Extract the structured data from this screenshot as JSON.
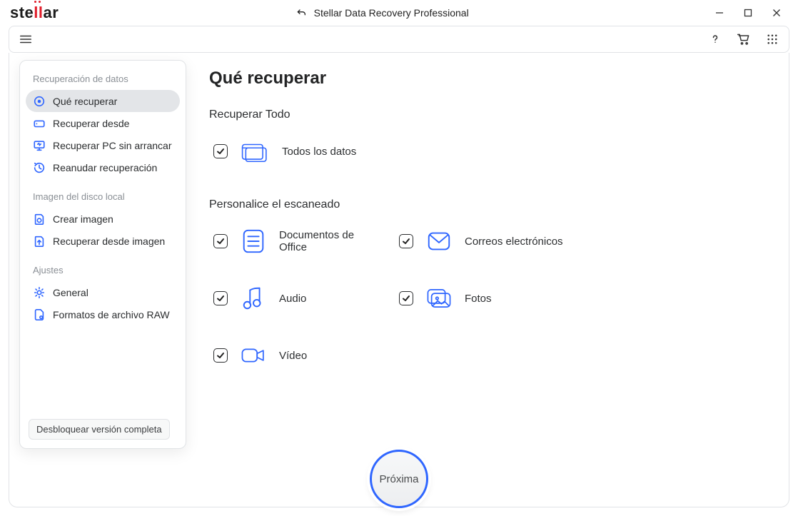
{
  "title": "Stellar Data Recovery Professional",
  "logo": {
    "part1": "ste",
    "part2": "ll",
    "part3": "ar"
  },
  "sidebar": {
    "sections": [
      {
        "title": "Recuperación de datos",
        "items": [
          {
            "label": "Qué recuperar",
            "icon": "target",
            "selected": true
          },
          {
            "label": "Recuperar desde",
            "icon": "drive",
            "selected": false
          },
          {
            "label": "Recuperar PC sin arrancar",
            "icon": "monitor",
            "selected": false
          },
          {
            "label": "Reanudar recuperación",
            "icon": "resume",
            "selected": false
          }
        ]
      },
      {
        "title": "Imagen del disco local",
        "items": [
          {
            "label": "Crear imagen",
            "icon": "disk-plus",
            "selected": false
          },
          {
            "label": "Recuperar desde imagen",
            "icon": "disk-up",
            "selected": false
          }
        ]
      },
      {
        "title": "Ajustes",
        "items": [
          {
            "label": "General",
            "icon": "gear",
            "selected": false
          },
          {
            "label": "Formatos de archivo RAW",
            "icon": "file-cog",
            "selected": false
          }
        ]
      }
    ],
    "unlock_label": "Desbloquear versión completa"
  },
  "main": {
    "heading": "Qué recuperar",
    "section_all_title": "Recuperar Todo",
    "all_data": {
      "label": "Todos los datos",
      "checked": true
    },
    "section_custom_title": "Personalice el escaneado",
    "types": [
      {
        "key": "office",
        "label": "Documentos de Office",
        "checked": true
      },
      {
        "key": "emails",
        "label": "Correos electrónicos",
        "checked": true
      },
      {
        "key": "audio",
        "label": "Audio",
        "checked": true
      },
      {
        "key": "photos",
        "label": "Fotos",
        "checked": true
      },
      {
        "key": "video",
        "label": "Vídeo",
        "checked": true
      }
    ],
    "next_label": "Próxima"
  }
}
